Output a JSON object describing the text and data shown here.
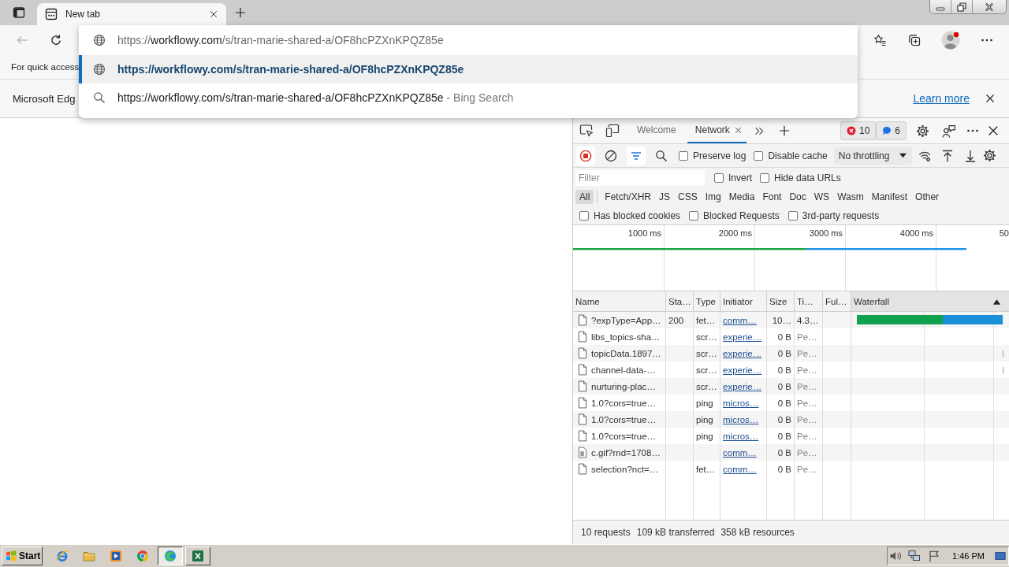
{
  "browser": {
    "tabs": [
      {
        "title": "New tab",
        "selected": true
      }
    ]
  },
  "toolbar": {
    "back": {
      "disabled": true
    }
  },
  "omnibox": {
    "scheme": "https://",
    "host": "workflowy.com",
    "path": "/s/tran-marie-shared-a/OF8hcPZXnKPQZ85e",
    "suggestions": [
      {
        "kind": "url",
        "text": "https://workflowy.com/s/tran-marie-shared-a/OF8hcPZXnKPQZ85e",
        "selected": true
      },
      {
        "kind": "search",
        "text": "https://workflowy.com/s/tran-marie-shared-a/OF8hcPZXnKPQZ85e",
        "suffix": " - Bing Search",
        "selected": false
      }
    ]
  },
  "favorites_bar": {
    "hint": "For quick access"
  },
  "infobar": {
    "message": "Microsoft Edg",
    "link": "Learn more"
  },
  "devtools": {
    "tabs": [
      {
        "label": "Welcome",
        "selected": false
      },
      {
        "label": "Network",
        "selected": true
      }
    ],
    "issues": {
      "errors": "10",
      "messages": "6"
    },
    "toolbar": {
      "recording": true,
      "filter_active": true,
      "checkboxes": [
        {
          "label": "Preserve log",
          "checked": false
        },
        {
          "label": "Disable cache",
          "checked": false
        }
      ],
      "throttling": "No throttling"
    },
    "filter": {
      "placeholder": "Filter",
      "checkboxes": [
        {
          "label": "Invert",
          "checked": false
        },
        {
          "label": "Hide data URLs",
          "checked": false
        }
      ]
    },
    "types": [
      {
        "label": "All",
        "selected": true
      },
      {
        "label": "Fetch/XHR",
        "selected": false
      },
      {
        "label": "JS",
        "selected": false
      },
      {
        "label": "CSS",
        "selected": false
      },
      {
        "label": "Img",
        "selected": false
      },
      {
        "label": "Media",
        "selected": false
      },
      {
        "label": "Font",
        "selected": false
      },
      {
        "label": "Doc",
        "selected": false
      },
      {
        "label": "WS",
        "selected": false
      },
      {
        "label": "Wasm",
        "selected": false
      },
      {
        "label": "Manifest",
        "selected": false
      },
      {
        "label": "Other",
        "selected": false
      }
    ],
    "options": [
      {
        "label": "Has blocked cookies",
        "checked": false
      },
      {
        "label": "Blocked Requests",
        "checked": false
      },
      {
        "label": "3rd-party requests",
        "checked": false
      }
    ],
    "overview": {
      "ticks": [
        "1000 ms",
        "2000 ms",
        "3000 ms",
        "4000 ms",
        "50"
      ]
    },
    "table": {
      "columns": [
        {
          "label": "Name",
          "sorted": false
        },
        {
          "label": "Sta…",
          "sorted": false
        },
        {
          "label": "Type",
          "sorted": false
        },
        {
          "label": "Initiator",
          "sorted": false
        },
        {
          "label": "Size",
          "sorted": false
        },
        {
          "label": "Ti…",
          "sorted": false
        },
        {
          "label": "Ful…",
          "sorted": false
        },
        {
          "label": "Waterfall",
          "sorted": true
        }
      ],
      "rows": [
        {
          "kind": "document",
          "name": "?expType=App…",
          "status": "200",
          "type": "fet…",
          "initiator": "comm…",
          "size": "10…",
          "time": "4.3…",
          "pending": false,
          "waterfall": {
            "kind": "bar"
          }
        },
        {
          "kind": "document",
          "name": "libs_topics-sha…",
          "type": "scr…",
          "initiator": "experie…",
          "size": "0 B",
          "time": "Pe…",
          "pending": true
        },
        {
          "kind": "document",
          "name": "topicData.1897…",
          "type": "scr…",
          "initiator": "experie…",
          "size": "0 B",
          "time": "Pe…",
          "pending": true,
          "waterfall": {
            "kind": "tick"
          }
        },
        {
          "kind": "document",
          "name": "channel-data-…",
          "type": "scr…",
          "initiator": "experie…",
          "size": "0 B",
          "time": "Pe…",
          "pending": true,
          "waterfall": {
            "kind": "tick"
          }
        },
        {
          "kind": "document",
          "name": "nurturing-plac…",
          "type": "scr…",
          "initiator": "experie…",
          "size": "0 B",
          "time": "Pe…",
          "pending": true
        },
        {
          "kind": "document",
          "name": "1.0?cors=true…",
          "type": "ping",
          "initiator": "micros…",
          "size": "0 B",
          "time": "Pe…",
          "pending": true
        },
        {
          "kind": "document",
          "name": "1.0?cors=true…",
          "type": "ping",
          "initiator": "micros…",
          "size": "0 B",
          "time": "Pe…",
          "pending": true
        },
        {
          "kind": "document",
          "name": "1.0?cors=true…",
          "type": "ping",
          "initiator": "micros…",
          "size": "0 B",
          "time": "Pe…",
          "pending": true
        },
        {
          "kind": "image",
          "name": "c.gif?rnd=1708…",
          "initiator": "comm…",
          "size": "0 B",
          "time": "Pe…",
          "pending": true
        },
        {
          "kind": "document",
          "name": "selection?nct=…",
          "type": "fet…",
          "initiator": "comm…",
          "size": "0 B",
          "time": "Pe…",
          "pending": true
        }
      ]
    },
    "summary": [
      "10 requests",
      "109 kB transferred",
      "358 kB resources"
    ]
  },
  "taskbar": {
    "start": "Start",
    "pinned": [
      {
        "kind": "browser-e"
      },
      {
        "kind": "folder"
      },
      {
        "kind": "player"
      },
      {
        "kind": "browser-wheel"
      }
    ],
    "tasks": [
      {
        "kind": "browser-wave",
        "selected": true
      },
      {
        "kind": "spreadsheet",
        "selected": false
      }
    ],
    "clock": "1:46 PM"
  }
}
